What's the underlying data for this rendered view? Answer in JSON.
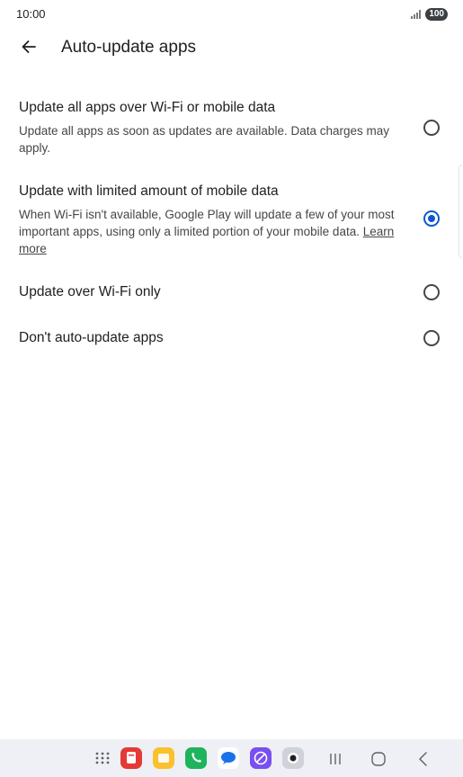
{
  "status_bar": {
    "time": "10:00",
    "battery": "100"
  },
  "header": {
    "title": "Auto-update apps"
  },
  "options": [
    {
      "title": "Update all apps over Wi-Fi or mobile data",
      "description": "Update all apps as soon as updates are available. Data charges may apply.",
      "selected": false
    },
    {
      "title": "Update with limited amount of mobile data",
      "description": "When Wi-Fi isn't available, Google Play will update a few of your most important apps, using only a limited portion of your mobile data.",
      "link": "Learn more",
      "selected": true
    },
    {
      "title": "Update over Wi-Fi only",
      "selected": false
    },
    {
      "title": "Don't auto-update apps",
      "selected": false
    }
  ],
  "dock": [
    {
      "name": "app-drawer-icon"
    },
    {
      "name": "app-red-icon",
      "color": "#e53935"
    },
    {
      "name": "app-notes-icon",
      "color": "#fbc02d"
    },
    {
      "name": "phone-icon",
      "color": "#1eb35d"
    },
    {
      "name": "messages-icon",
      "color": "#1a73e8"
    },
    {
      "name": "internet-icon",
      "color": "#7a4ff0"
    },
    {
      "name": "camera-icon",
      "color": "#cfd2d8"
    }
  ],
  "colors": {
    "accent": "#0b57d0",
    "text_primary": "#1f1f1f",
    "text_secondary": "#444746",
    "nav_background": "#eef0f5"
  }
}
